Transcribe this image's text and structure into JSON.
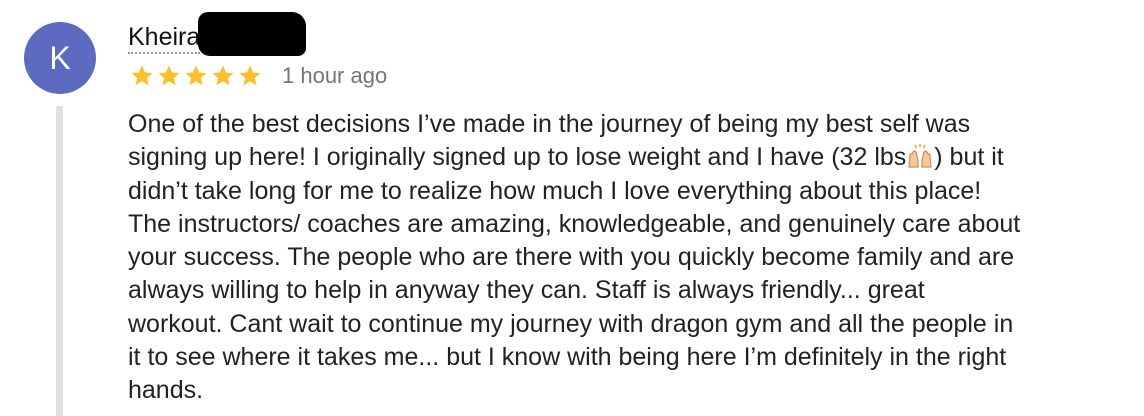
{
  "review": {
    "avatar_letter": "K",
    "avatar_color": "#5c6bc0",
    "reviewer_name": "Kheira",
    "rating": 5,
    "rating_max": 5,
    "star_color": "#fbc02d",
    "time_ago": "1 hour ago",
    "text_part1": "One of the best decisions I’ve made in the journey of being my best self was\nsigning up here! I originally signed up to lose weight and I have (32 lbs",
    "emoji": "raising-hands-emoji",
    "text_part2": ") but it\ndidn’t take long for me to realize how much I love everything about this place!\nThe instructors/ coaches are amazing, knowledgeable, and genuinely care about\nyour success. The people who are there with you quickly become family and are\nalways willing to help in anyway they can. Staff is always friendly... great\nworkout. Cant wait to continue my journey with dragon gym and all the people in\nit to see where it takes me... but I know with being here I’m definitely in the right\nhands."
  }
}
